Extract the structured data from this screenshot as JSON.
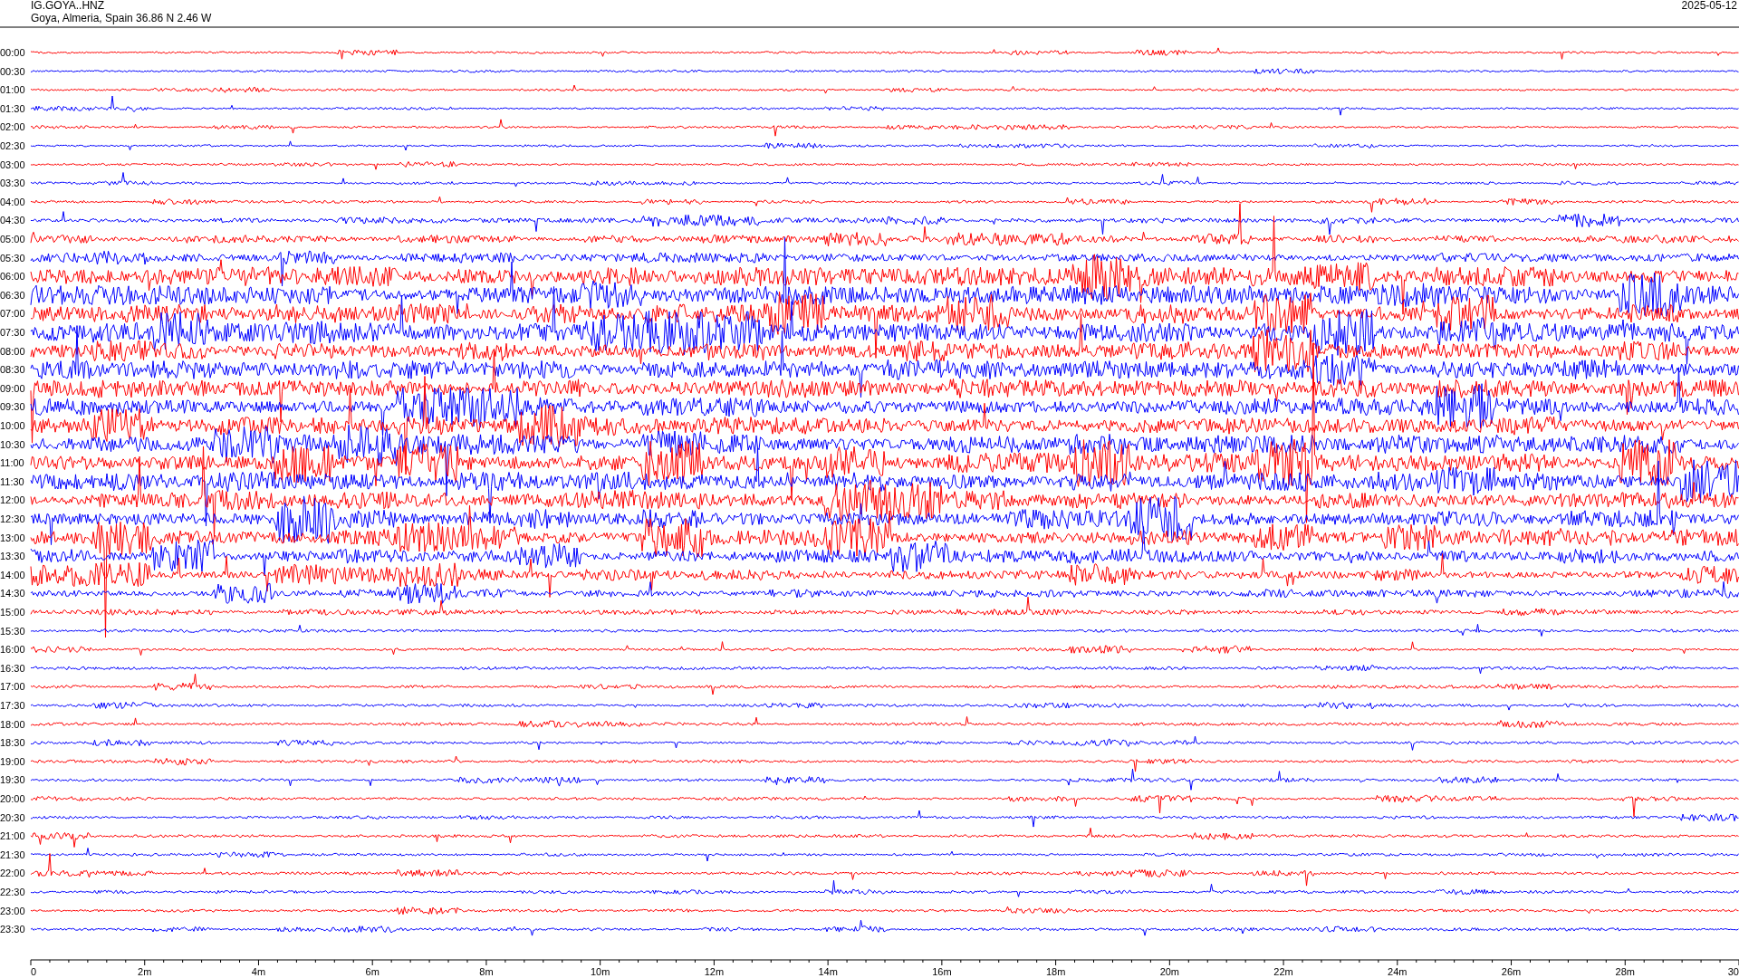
{
  "header": {
    "station": "IG.GOYA..HNZ",
    "location": "Goya, Almeria, Spain  36.86 N 2.46 W",
    "date": "2025-05-12"
  },
  "traces": [
    {
      "label": "00:00",
      "color": "#ff0000"
    },
    {
      "label": "00:30",
      "color": "#0000ff"
    },
    {
      "label": "01:00",
      "color": "#ff0000"
    },
    {
      "label": "01:30",
      "color": "#0000ff"
    },
    {
      "label": "02:00",
      "color": "#ff0000"
    },
    {
      "label": "02:30",
      "color": "#0000ff"
    },
    {
      "label": "03:00",
      "color": "#ff0000"
    },
    {
      "label": "03:30",
      "color": "#0000ff"
    },
    {
      "label": "04:00",
      "color": "#ff0000"
    },
    {
      "label": "04:30",
      "color": "#0000ff"
    },
    {
      "label": "05:00",
      "color": "#ff0000"
    },
    {
      "label": "05:30",
      "color": "#0000ff"
    },
    {
      "label": "06:00",
      "color": "#ff0000"
    },
    {
      "label": "06:30",
      "color": "#0000ff"
    },
    {
      "label": "07:00",
      "color": "#ff0000"
    },
    {
      "label": "07:30",
      "color": "#0000ff"
    },
    {
      "label": "08:00",
      "color": "#ff0000"
    },
    {
      "label": "08:30",
      "color": "#0000ff"
    },
    {
      "label": "09:00",
      "color": "#ff0000"
    },
    {
      "label": "09:30",
      "color": "#0000ff"
    },
    {
      "label": "10:00",
      "color": "#ff0000"
    },
    {
      "label": "10:30",
      "color": "#0000ff"
    },
    {
      "label": "11:00",
      "color": "#ff0000"
    },
    {
      "label": "11:30",
      "color": "#0000ff"
    },
    {
      "label": "12:00",
      "color": "#ff0000"
    },
    {
      "label": "12:30",
      "color": "#0000ff"
    },
    {
      "label": "13:00",
      "color": "#ff0000"
    },
    {
      "label": "13:30",
      "color": "#0000ff"
    },
    {
      "label": "14:00",
      "color": "#ff0000"
    },
    {
      "label": "14:30",
      "color": "#0000ff"
    },
    {
      "label": "15:00",
      "color": "#ff0000"
    },
    {
      "label": "15:30",
      "color": "#0000ff"
    },
    {
      "label": "16:00",
      "color": "#ff0000"
    },
    {
      "label": "16:30",
      "color": "#0000ff"
    },
    {
      "label": "17:00",
      "color": "#ff0000"
    },
    {
      "label": "17:30",
      "color": "#0000ff"
    },
    {
      "label": "18:00",
      "color": "#ff0000"
    },
    {
      "label": "18:30",
      "color": "#0000ff"
    },
    {
      "label": "19:00",
      "color": "#ff0000"
    },
    {
      "label": "19:30",
      "color": "#0000ff"
    },
    {
      "label": "20:00",
      "color": "#ff0000"
    },
    {
      "label": "20:30",
      "color": "#0000ff"
    },
    {
      "label": "21:00",
      "color": "#ff0000"
    },
    {
      "label": "21:30",
      "color": "#0000ff"
    },
    {
      "label": "22:00",
      "color": "#ff0000"
    },
    {
      "label": "22:30",
      "color": "#0000ff"
    },
    {
      "label": "23:00",
      "color": "#ff0000"
    },
    {
      "label": "23:30",
      "color": "#0000ff"
    }
  ],
  "x_axis": {
    "labels": [
      "0",
      "2m",
      "4m",
      "6m",
      "8m",
      "10m",
      "12m",
      "14m",
      "16m",
      "18m",
      "20m",
      "22m",
      "24m",
      "26m",
      "28m",
      "30"
    ]
  }
}
